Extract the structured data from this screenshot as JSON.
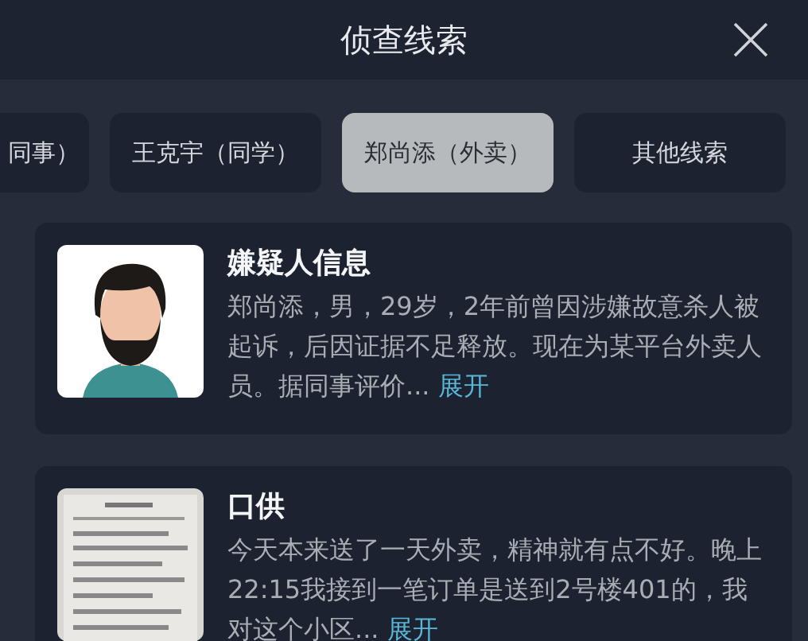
{
  "header": {
    "title": "侦查线索"
  },
  "tabs": [
    {
      "label": "同事）",
      "selected": false
    },
    {
      "label": "王克宇（同学）",
      "selected": false
    },
    {
      "label": "郑尚添（外卖）",
      "selected": true
    },
    {
      "label": "其他线索",
      "selected": false
    }
  ],
  "cards": [
    {
      "kind": "avatar",
      "title": "嫌疑人信息",
      "body": "郑尚添，男，29岁，2年前曾因涉嫌故意杀人被起诉，后因证据不足释放。现在为某平台外卖人员。据同事评价...",
      "link": "展开"
    },
    {
      "kind": "picture",
      "title": "口供",
      "body": "今天本来送了一天外卖，精神就有点不好。晚上22:15我接到一笔订单是送到2号楼401的，我对这个小区...",
      "link": "展开"
    }
  ]
}
